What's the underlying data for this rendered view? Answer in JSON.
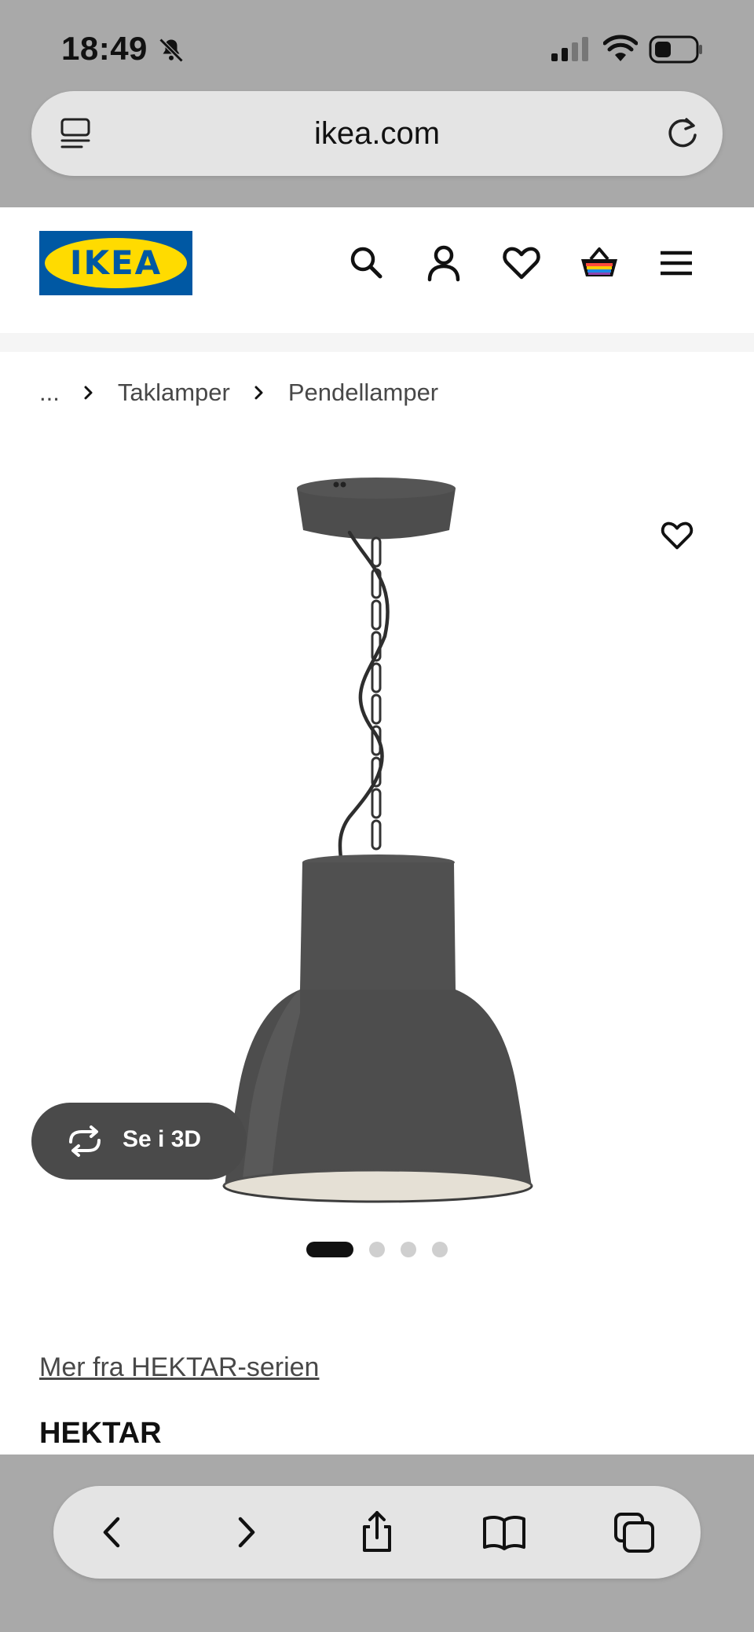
{
  "status_bar": {
    "time": "18:49",
    "icons": [
      "bell-slash-icon",
      "cellular-signal-icon",
      "wifi-icon",
      "battery-icon"
    ]
  },
  "browser": {
    "url": "ikea.com",
    "left_icon": "page-menu-icon",
    "right_icon": "reload-icon",
    "toolbar_icons": [
      "back-icon",
      "forward-icon",
      "share-icon",
      "bookmarks-icon",
      "tabs-icon"
    ]
  },
  "header": {
    "logo_text": "IKEA",
    "logo_colors": {
      "blue": "#0058a3",
      "yellow": "#ffdb00"
    },
    "icons": [
      "search-icon",
      "account-icon",
      "favorites-icon",
      "cart-icon",
      "menu-icon"
    ]
  },
  "breadcrumb": {
    "items": [
      "...",
      "Taklamper",
      "Pendellamper"
    ]
  },
  "product": {
    "three_d_label": "Se i 3D",
    "carousel": {
      "total": 4,
      "active": 1
    },
    "series_link": "Mer fra HEKTAR-serien",
    "name": "HEKTAR",
    "lamp_color": "#4d4d4d"
  }
}
